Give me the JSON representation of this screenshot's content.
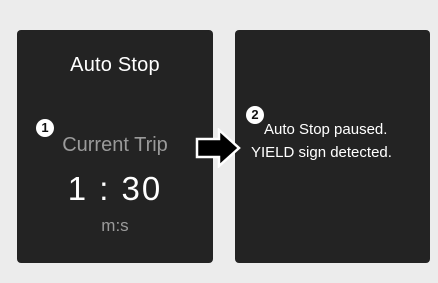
{
  "left_panel": {
    "title": "Auto Stop",
    "badge": "1",
    "subtitle": "Current Trip",
    "time": "1 : 30",
    "unit": "m:s"
  },
  "right_panel": {
    "badge": "2",
    "message_line1": "Auto Stop paused.",
    "message_line2": "YIELD sign detected."
  },
  "arrow": {
    "icon": "right-arrow-icon"
  }
}
